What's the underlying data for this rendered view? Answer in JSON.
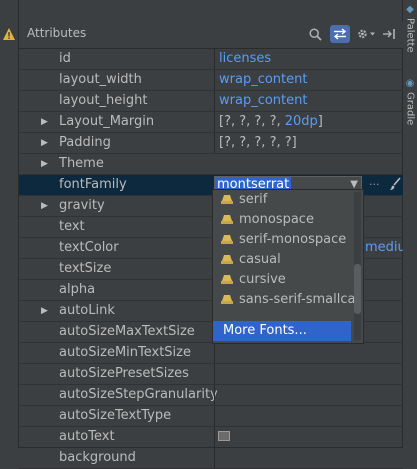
{
  "panel": {
    "title": "Attributes",
    "right_tabs": [
      "Palette",
      "Gradle"
    ]
  },
  "rows": [
    {
      "name": "id",
      "value": "licenses",
      "value_style": "link",
      "expandable": false
    },
    {
      "name": "layout_width",
      "value": "wrap_content",
      "value_style": "link",
      "expandable": false
    },
    {
      "name": "layout_height",
      "value": "wrap_content",
      "value_style": "link",
      "expandable": false
    },
    {
      "name": "Layout_Margin",
      "value_prefix": "[?, ?, ?, ?, ",
      "value_blue": "20dp",
      "value_suffix": "]",
      "expandable": true
    },
    {
      "name": "Padding",
      "value": "[?, ?, ?, ?, ?]",
      "value_style": "plain",
      "expandable": true
    },
    {
      "name": "Theme",
      "value": "",
      "expandable": true
    },
    {
      "name": "fontFamily",
      "value": "montserrat",
      "expandable": false,
      "selected": true
    },
    {
      "name": "gravity",
      "value": "",
      "expandable": true
    },
    {
      "name": "text",
      "value": "",
      "expandable": false
    },
    {
      "name": "textColor",
      "value": "mediu",
      "expandable": false
    },
    {
      "name": "textSize",
      "value": "",
      "expandable": false
    },
    {
      "name": "alpha",
      "value": "",
      "expandable": false
    },
    {
      "name": "autoLink",
      "value": "",
      "expandable": true
    },
    {
      "name": "autoSizeMaxTextSize",
      "value": "",
      "expandable": false
    },
    {
      "name": "autoSizeMinTextSize",
      "value": "",
      "expandable": false
    },
    {
      "name": "autoSizePresetSizes",
      "value": "",
      "expandable": false
    },
    {
      "name": "autoSizeStepGranularity",
      "value": "",
      "expandable": false
    },
    {
      "name": "autoSizeTextType",
      "value": "",
      "expandable": false
    },
    {
      "name": "autoText",
      "value": "",
      "expandable": false
    },
    {
      "name": "background",
      "value": "",
      "expandable": false
    }
  ],
  "font_dropdown": {
    "options": [
      "serif",
      "monospace",
      "serif-monospace",
      "casual",
      "cursive",
      "sans-serif-smallca"
    ],
    "more_label": "More Fonts...",
    "option_icon": "font-icon"
  },
  "ellipsis": "···",
  "colors": {
    "accent": "#2f65ca",
    "link": "#589df6",
    "background": "#3c3f41"
  }
}
